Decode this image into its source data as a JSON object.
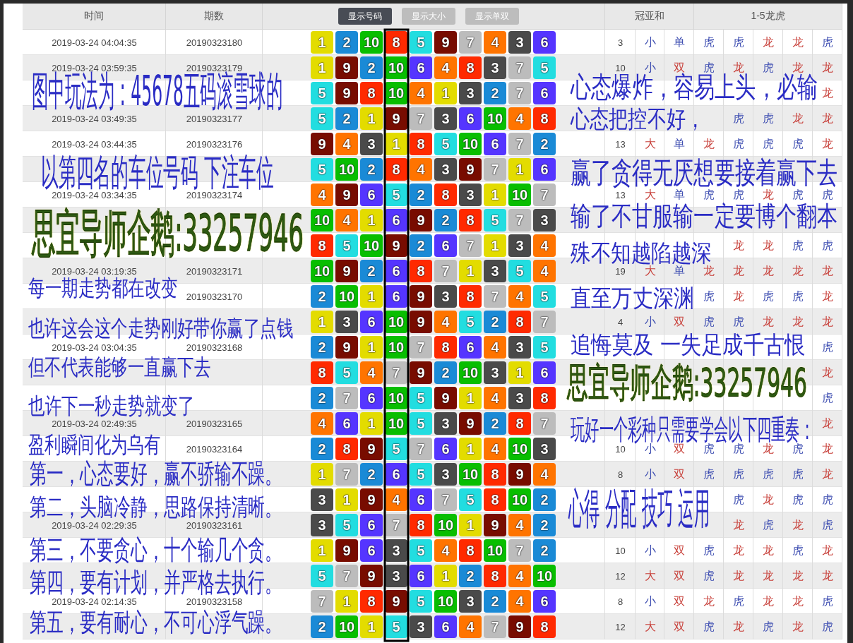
{
  "table": {
    "columns": [
      {
        "label": "时间"
      },
      {
        "label": "期数"
      },
      {
        "label": "冠亚和"
      },
      {
        "label": "1-5龙虎"
      }
    ],
    "toggles": [
      {
        "label": "显示号码",
        "selected": true
      },
      {
        "label": "显示大小",
        "selected": false
      },
      {
        "label": "显示单双",
        "selected": false
      }
    ],
    "rows": [
      {
        "time": "2019-03-24 04:04:35",
        "period": "20190323180",
        "numbers": [
          "1",
          "2",
          "10",
          "8",
          "5",
          "9",
          "7",
          "4",
          "3",
          "6"
        ],
        "sum": "3",
        "size": {
          "text": "小",
          "color": "#3b4bb0"
        },
        "parity": {
          "text": "单",
          "color": "#3b4bb0"
        },
        "dragon_tiger": {
          "pos_1": {
            "text": "虎",
            "color": "#3b4bb0"
          },
          "pos_2": {
            "text": "虎",
            "color": "#3b4bb0"
          },
          "pos_3": {
            "text": "龙",
            "color": "#c8403a"
          },
          "pos_4": {
            "text": "龙",
            "color": "#c8403a"
          },
          "pos_5": {
            "text": "虎",
            "color": "#3b4bb0"
          }
        }
      },
      {
        "time": "2019-03-24 03:59:35",
        "period": "20190323179",
        "numbers": [
          "1",
          "9",
          "2",
          "10",
          "6",
          "4",
          "8",
          "3",
          "7",
          "5"
        ],
        "sum": "10",
        "size": {
          "text": "小",
          "color": "#3b4bb0"
        },
        "parity": {
          "text": "双",
          "color": "#c8403a"
        },
        "dragon_tiger": {
          "pos_1": {
            "text": "虎",
            "color": "#3b4bb0"
          },
          "pos_2": {
            "text": "龙",
            "color": "#c8403a"
          },
          "pos_3": {
            "text": "虎",
            "color": "#3b4bb0"
          },
          "pos_4": {
            "text": "龙",
            "color": "#c8403a"
          },
          "pos_5": {
            "text": "龙",
            "color": "#c8403a"
          }
        }
      },
      {
        "numbers": [
          "5",
          "9",
          "8",
          "10",
          "4",
          "1",
          "3",
          "2",
          "7",
          "6"
        ],
        "dragon_tiger": {
          "pos_5": {
            "text": "龙",
            "color": "#c8403a"
          }
        }
      },
      {
        "time": "2019-03-24 03:49:35",
        "period": "20190323177",
        "numbers": [
          "5",
          "2",
          "1",
          "9",
          "7",
          "3",
          "6",
          "10",
          "4",
          "8"
        ],
        "dragon_tiger": {
          "pos_2": {
            "text": "虎",
            "color": "#3b4bb0"
          },
          "pos_3": {
            "text": "虎",
            "color": "#3b4bb0"
          },
          "pos_4": {
            "text": "龙",
            "color": "#c8403a"
          },
          "pos_5": {
            "text": "龙",
            "color": "#c8403a"
          }
        }
      },
      {
        "time": "2019-03-24 03:44:35",
        "period": "20190323176",
        "numbers": [
          "9",
          "4",
          "3",
          "1",
          "8",
          "5",
          "10",
          "6",
          "7",
          "2"
        ],
        "sum": "13",
        "size": {
          "text": "大",
          "color": "#c8403a"
        },
        "parity": {
          "text": "单",
          "color": "#3b4bb0"
        },
        "dragon_tiger": {
          "pos_1": {
            "text": "龙",
            "color": "#c8403a"
          },
          "pos_2": {
            "text": "虎",
            "color": "#3b4bb0"
          },
          "pos_3": {
            "text": "虎",
            "color": "#3b4bb0"
          },
          "pos_4": {
            "text": "虎",
            "color": "#3b4bb0"
          },
          "pos_5": {
            "text": "龙",
            "color": "#c8403a"
          }
        }
      },
      {
        "numbers": [
          "5",
          "10",
          "2",
          "8",
          "4",
          "3",
          "9",
          "7",
          "1",
          "6"
        ]
      },
      {
        "time": "2019-03-24 03:34:35",
        "period": "20190323174",
        "numbers": [
          "4",
          "9",
          "6",
          "5",
          "2",
          "8",
          "3",
          "1",
          "10",
          "7"
        ],
        "sum": "13",
        "size": {
          "text": "大",
          "color": "#c8403a"
        },
        "parity": {
          "text": "单",
          "color": "#3b4bb0"
        },
        "dragon_tiger": {
          "pos_1": {
            "text": "虎",
            "color": "#3b4bb0"
          },
          "pos_2": {
            "text": "虎",
            "color": "#3b4bb0"
          },
          "pos_3": {
            "text": "龙",
            "color": "#c8403a"
          },
          "pos_4": {
            "text": "虎",
            "color": "#3b4bb0"
          },
          "pos_5": {
            "text": "虎",
            "color": "#3b4bb0"
          }
        }
      },
      {
        "numbers": [
          "10",
          "4",
          "1",
          "6",
          "9",
          "2",
          "8",
          "5",
          "7",
          "3"
        ]
      },
      {
        "numbers": [
          "8",
          "5",
          "10",
          "9",
          "2",
          "6",
          "7",
          "1",
          "3",
          "4"
        ],
        "dragon_tiger": {
          "pos_2": {
            "text": "龙",
            "color": "#c8403a"
          },
          "pos_3": {
            "text": "龙",
            "color": "#c8403a"
          },
          "pos_4": {
            "text": "虎",
            "color": "#3b4bb0"
          },
          "pos_5": {
            "text": "虎",
            "color": "#3b4bb0"
          }
        }
      },
      {
        "time": "2019-03-24 03:19:35",
        "period": "20190323171",
        "numbers": [
          "10",
          "9",
          "2",
          "6",
          "8",
          "7",
          "1",
          "3",
          "5",
          "4"
        ],
        "sum": "19",
        "size": {
          "text": "大",
          "color": "#c8403a"
        },
        "parity": {
          "text": "单",
          "color": "#3b4bb0"
        },
        "dragon_tiger": {
          "pos_1": {
            "text": "龙",
            "color": "#c8403a"
          },
          "pos_2": {
            "text": "龙",
            "color": "#c8403a"
          },
          "pos_3": {
            "text": "龙",
            "color": "#c8403a"
          },
          "pos_4": {
            "text": "龙",
            "color": "#c8403a"
          },
          "pos_5": {
            "text": "龙",
            "color": "#c8403a"
          }
        }
      },
      {
        "period": "20190323170",
        "numbers": [
          "2",
          "10",
          "1",
          "6",
          "9",
          "3",
          "8",
          "7",
          "4",
          "5"
        ],
        "dragon_tiger": {
          "pos_1": {
            "text": "虎",
            "color": "#3b4bb0"
          },
          "pos_2": {
            "text": "龙",
            "color": "#c8403a"
          },
          "pos_3": {
            "text": "虎",
            "color": "#3b4bb0"
          },
          "pos_4": {
            "text": "虎",
            "color": "#3b4bb0"
          },
          "pos_5": {
            "text": "龙",
            "color": "#c8403a"
          }
        }
      },
      {
        "numbers": [
          "1",
          "3",
          "6",
          "10",
          "9",
          "4",
          "5",
          "2",
          "8",
          "7"
        ],
        "sum": "4",
        "size": {
          "text": "小",
          "color": "#3b4bb0"
        },
        "parity": {
          "text": "双",
          "color": "#c8403a"
        },
        "dragon_tiger": {
          "pos_1": {
            "text": "虎",
            "color": "#3b4bb0"
          },
          "pos_2": {
            "text": "虎",
            "color": "#3b4bb0"
          },
          "pos_3": {
            "text": "龙",
            "color": "#c8403a"
          },
          "pos_4": {
            "text": "龙",
            "color": "#c8403a"
          },
          "pos_5": {
            "text": "龙",
            "color": "#c8403a"
          }
        }
      },
      {
        "time": "2019-03-24 03:04:35",
        "period": "20190323168",
        "numbers": [
          "2",
          "9",
          "1",
          "10",
          "7",
          "8",
          "6",
          "4",
          "3",
          "5"
        ],
        "dragon_tiger": {
          "pos_5": {
            "text": "虎",
            "color": "#3b4bb0"
          }
        }
      },
      {
        "numbers": [
          "8",
          "5",
          "4",
          "7",
          "9",
          "2",
          "10",
          "3",
          "1",
          "6"
        ],
        "dragon_tiger": {
          "pos_5": {
            "text": "龙",
            "color": "#c8403a"
          }
        }
      },
      {
        "numbers": [
          "2",
          "7",
          "6",
          "10",
          "5",
          "9",
          "1",
          "4",
          "3",
          "8"
        ],
        "dragon_tiger": {
          "pos_5": {
            "text": "虎",
            "color": "#3b4bb0"
          }
        }
      },
      {
        "time": "2019-03-24 02:49:35",
        "period": "20190323165",
        "numbers": [
          "4",
          "6",
          "1",
          "10",
          "5",
          "3",
          "9",
          "2",
          "8",
          "7"
        ],
        "dragon_tiger": {
          "pos_5": {
            "text": "龙",
            "color": "#c8403a"
          }
        }
      },
      {
        "period": "20190323164",
        "numbers": [
          "2",
          "8",
          "9",
          "5",
          "7",
          "6",
          "1",
          "4",
          "10",
          "3"
        ],
        "sum": "10",
        "size": {
          "text": "小",
          "color": "#3b4bb0"
        },
        "parity": {
          "text": "双",
          "color": "#c8403a"
        },
        "dragon_tiger": {
          "pos_1": {
            "text": "虎",
            "color": "#3b4bb0"
          },
          "pos_2": {
            "text": "虎",
            "color": "#3b4bb0"
          },
          "pos_3": {
            "text": "龙",
            "color": "#c8403a"
          },
          "pos_4": {
            "text": "虎",
            "color": "#3b4bb0"
          },
          "pos_5": {
            "text": "龙",
            "color": "#c8403a"
          }
        }
      },
      {
        "numbers": [
          "1",
          "7",
          "2",
          "6",
          "5",
          "3",
          "10",
          "8",
          "9",
          "4"
        ],
        "sum": "8",
        "size": {
          "text": "小",
          "color": "#3b4bb0"
        },
        "parity": {
          "text": "双",
          "color": "#c8403a"
        },
        "dragon_tiger": {
          "pos_1": {
            "text": "虎",
            "color": "#3b4bb0"
          },
          "pos_2": {
            "text": "虎",
            "color": "#3b4bb0"
          },
          "pos_3": {
            "text": "虎",
            "color": "#3b4bb0"
          },
          "pos_4": {
            "text": "虎",
            "color": "#3b4bb0"
          },
          "pos_5": {
            "text": "龙",
            "color": "#c8403a"
          }
        }
      },
      {
        "numbers": [
          "3",
          "1",
          "9",
          "4",
          "6",
          "7",
          "5",
          "8",
          "10",
          "2"
        ],
        "dragon_tiger": {
          "pos_2": {
            "text": "虎",
            "color": "#3b4bb0"
          },
          "pos_3": {
            "text": "龙",
            "color": "#c8403a"
          },
          "pos_4": {
            "text": "虎",
            "color": "#3b4bb0"
          },
          "pos_5": {
            "text": "虎",
            "color": "#3b4bb0"
          }
        }
      },
      {
        "time": "2019-03-24 02:29:35",
        "period": "20190323161",
        "numbers": [
          "3",
          "5",
          "6",
          "7",
          "8",
          "10",
          "1",
          "9",
          "4",
          "2"
        ],
        "dragon_tiger": {
          "pos_2": {
            "text": "龙",
            "color": "#c8403a"
          },
          "pos_3": {
            "text": "虎",
            "color": "#3b4bb0"
          },
          "pos_4": {
            "text": "龙",
            "color": "#c8403a"
          },
          "pos_5": {
            "text": "虎",
            "color": "#3b4bb0"
          }
        }
      },
      {
        "numbers": [
          "1",
          "9",
          "6",
          "3",
          "5",
          "4",
          "8",
          "10",
          "7",
          "2"
        ],
        "sum": "10",
        "size": {
          "text": "小",
          "color": "#3b4bb0"
        },
        "parity": {
          "text": "双",
          "color": "#c8403a"
        },
        "dragon_tiger": {
          "pos_1": {
            "text": "虎",
            "color": "#3b4bb0"
          },
          "pos_2": {
            "text": "龙",
            "color": "#c8403a"
          },
          "pos_3": {
            "text": "龙",
            "color": "#c8403a"
          },
          "pos_4": {
            "text": "虎",
            "color": "#3b4bb0"
          },
          "pos_5": {
            "text": "龙",
            "color": "#c8403a"
          }
        }
      },
      {
        "numbers": [
          "5",
          "7",
          "9",
          "3",
          "6",
          "1",
          "2",
          "8",
          "4",
          "10"
        ],
        "sum": "12",
        "size": {
          "text": "大",
          "color": "#c8403a"
        },
        "parity": {
          "text": "双",
          "color": "#c8403a"
        },
        "dragon_tiger": {
          "pos_1": {
            "text": "虎",
            "color": "#3b4bb0"
          },
          "pos_2": {
            "text": "龙",
            "color": "#c8403a"
          },
          "pos_3": {
            "text": "龙",
            "color": "#c8403a"
          },
          "pos_4": {
            "text": "龙",
            "color": "#c8403a"
          },
          "pos_5": {
            "text": "龙",
            "color": "#c8403a"
          }
        }
      },
      {
        "time": "2019-03-24 02:14:35",
        "period": "20190323158",
        "numbers": [
          "7",
          "1",
          "8",
          "9",
          "5",
          "10",
          "3",
          "2",
          "4",
          "6"
        ],
        "sum": "8",
        "size": {
          "text": "小",
          "color": "#3b4bb0"
        },
        "parity": {
          "text": "双",
          "color": "#c8403a"
        },
        "dragon_tiger": {
          "pos_1": {
            "text": "龙",
            "color": "#c8403a"
          },
          "pos_2": {
            "text": "虎",
            "color": "#3b4bb0"
          },
          "pos_3": {
            "text": "龙",
            "color": "#c8403a"
          },
          "pos_4": {
            "text": "龙",
            "color": "#c8403a"
          },
          "pos_5": {
            "text": "虎",
            "color": "#3b4bb0"
          }
        }
      },
      {
        "numbers": [
          "2",
          "10",
          "1",
          "5",
          "3",
          "6",
          "4",
          "7",
          "9",
          "8"
        ],
        "sum": "12",
        "size": {
          "text": "大",
          "color": "#c8403a"
        },
        "parity": {
          "text": "双",
          "color": "#c8403a"
        },
        "dragon_tiger": {
          "pos_1": {
            "text": "虎",
            "color": "#3b4bb0"
          },
          "pos_2": {
            "text": "龙",
            "color": "#c8403a"
          },
          "pos_3": {
            "text": "虎",
            "color": "#3b4bb0"
          },
          "pos_4": {
            "text": "龙",
            "color": "#c8403a"
          },
          "pos_5": {
            "text": "虎",
            "color": "#3b4bb0"
          }
        }
      }
    ]
  },
  "annotations": [
    {
      "kind": "headline",
      "text": "图中玩法为：45678五码滚雪球的"
    },
    {
      "kind": "headline",
      "text": "以第四名的车位号码 下注车位"
    },
    {
      "kind": "contact",
      "text": "思宜导师企鹅:33257946"
    },
    {
      "kind": "line",
      "text": "每一期走势都在改变"
    },
    {
      "kind": "line",
      "text": "也许这会这个走势刚好带你赢了点钱"
    },
    {
      "kind": "line",
      "text": "但不代表能够一直赢下去"
    },
    {
      "kind": "line",
      "text": "也许下一秒走势就变了"
    },
    {
      "kind": "line",
      "text": "盈利瞬间化为乌有"
    },
    {
      "kind": "rule",
      "text": "第一，心态要好，赢不骄输不躁。"
    },
    {
      "kind": "rule",
      "text": "第二，头脑冷静，思路保持清晰。"
    },
    {
      "kind": "rule",
      "text": "第三，不要贪心，十个输几个贪。"
    },
    {
      "kind": "rule",
      "text": "第四，要有计划，并严格去执行。"
    },
    {
      "kind": "rule",
      "text": "第五，要有耐心，不可心浮气躁。"
    },
    {
      "kind": "line",
      "text": "心态爆炸，容易上头，必输"
    },
    {
      "kind": "line",
      "text": "心态把控不好，"
    },
    {
      "kind": "line",
      "text": "赢了贪得无厌想要接着赢下去"
    },
    {
      "kind": "line",
      "text": "输了不甘服输一定要博个翻本"
    },
    {
      "kind": "line",
      "text": "殊不知越陷越深"
    },
    {
      "kind": "line",
      "text": "直至万丈深渊"
    },
    {
      "kind": "line",
      "text": "追悔莫及 一失足成千古恨"
    },
    {
      "kind": "contact",
      "text": "思宜导师企鹅:33257946"
    },
    {
      "kind": "headline",
      "text": "玩好一个彩种只需要学会以下四重奏："
    },
    {
      "kind": "headline",
      "text": "心得 分配 技巧 运用"
    }
  ]
}
